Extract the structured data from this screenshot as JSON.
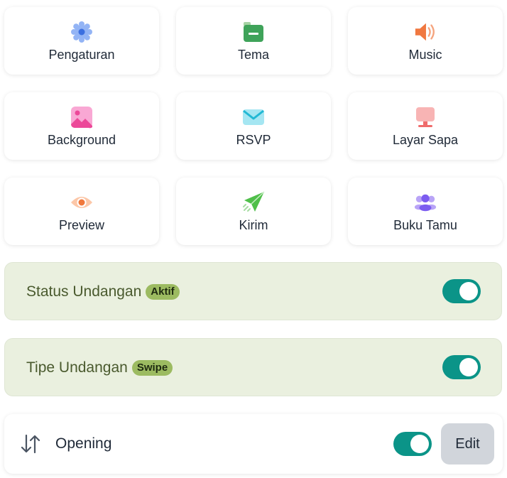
{
  "menu": [
    {
      "label": "Pengaturan",
      "icon": "gear-icon"
    },
    {
      "label": "Tema",
      "icon": "folder-icon"
    },
    {
      "label": "Music",
      "icon": "speaker-icon"
    },
    {
      "label": "Background",
      "icon": "image-icon"
    },
    {
      "label": "RSVP",
      "icon": "envelope-icon"
    },
    {
      "label": "Layar Sapa",
      "icon": "monitor-icon"
    },
    {
      "label": "Preview",
      "icon": "eye-icon"
    },
    {
      "label": "Kirim",
      "icon": "send-icon"
    },
    {
      "label": "Buku Tamu",
      "icon": "users-icon"
    }
  ],
  "status": {
    "label": "Status Undangan",
    "badge": "Aktif",
    "enabled": true
  },
  "tipe": {
    "label": "Tipe Undangan",
    "badge": "Swipe",
    "enabled": true
  },
  "opening": {
    "label": "Opening",
    "enabled": true,
    "edit_label": "Edit"
  },
  "colors": {
    "accent": "#0b9488",
    "row_bg": "#eaf0df",
    "badge_bg": "#9cbb61"
  }
}
